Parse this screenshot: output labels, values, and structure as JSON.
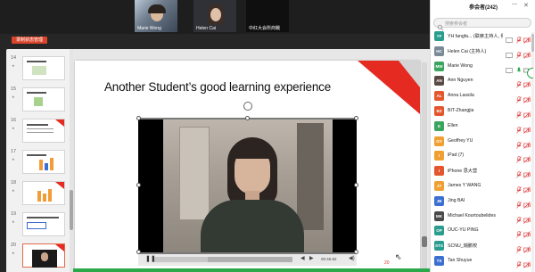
{
  "video_strip": {
    "tiles": [
      {
        "name": "Marie Wong"
      },
      {
        "name": "Helen Cai"
      },
      {
        "name": "中红大会所商戰"
      }
    ]
  },
  "recording_badge": "录制状态管理",
  "thumbnails": [
    {
      "number": "14",
      "star": "★"
    },
    {
      "number": "15",
      "star": "★"
    },
    {
      "number": "16",
      "star": "★"
    },
    {
      "number": "17",
      "star": "★"
    },
    {
      "number": "18",
      "star": "★"
    },
    {
      "number": "19",
      "star": "★"
    },
    {
      "number": "20",
      "star": "★"
    }
  ],
  "slide": {
    "title": "Another Student’s good learning experience"
  },
  "video_player": {
    "time": "00:46.82"
  },
  "page_indicator": "20",
  "panel": {
    "title": "参会者(242)",
    "search_placeholder": "搜索参会者"
  },
  "participants": [
    {
      "name": "YH fangfa... (联席主持人, 我)",
      "initials": "YF",
      "color": "#2a9d8f",
      "status": "muted"
    },
    {
      "name": "Helen Cai (主持人)",
      "initials": "HC",
      "color": "#7a8a99",
      "status": "muted"
    },
    {
      "name": "Marie Wong",
      "initials": "MW",
      "color": "#3aa55f",
      "status": "live"
    },
    {
      "name": "Ann Nguyen",
      "initials": "AN",
      "color": "#5a4a44",
      "status": "muted"
    },
    {
      "name": "Anna Lassila",
      "initials": "AL",
      "color": "#e4572e",
      "status": "muted"
    },
    {
      "name": "BIT-Zhangjia",
      "initials": "BZ",
      "color": "#e4572e",
      "status": "muted"
    },
    {
      "name": "Ellen",
      "initials": "E",
      "color": "#3aa55f",
      "status": "muted"
    },
    {
      "name": "Geoffrey YU",
      "initials": "GY",
      "color": "#f0a032",
      "status": "muted"
    },
    {
      "name": "iPad (7)",
      "initials": "I",
      "color": "#f0a032",
      "status": "muted"
    },
    {
      "name": "iPhone 思大营",
      "initials": "I",
      "color": "#e4572e",
      "status": "muted"
    },
    {
      "name": "James Y WANG",
      "initials": "JY",
      "color": "#f0a032",
      "status": "muted"
    },
    {
      "name": "Jing BAI",
      "initials": "JB",
      "color": "#3b6fd1",
      "status": "muted"
    },
    {
      "name": "Michael Kourtoubelides",
      "initials": "MK",
      "color": "#4a4a4a",
      "status": "muted"
    },
    {
      "name": "OUC-YU PING",
      "initials": "OP",
      "color": "#2a9d8f",
      "status": "muted"
    },
    {
      "name": "SCNU_瑞鹏校",
      "initials": "STS",
      "color": "#2a9d8f",
      "status": "muted"
    },
    {
      "name": "Tan Shuyue",
      "initials": "TS",
      "color": "#3b6fd1",
      "status": "muted"
    }
  ]
}
